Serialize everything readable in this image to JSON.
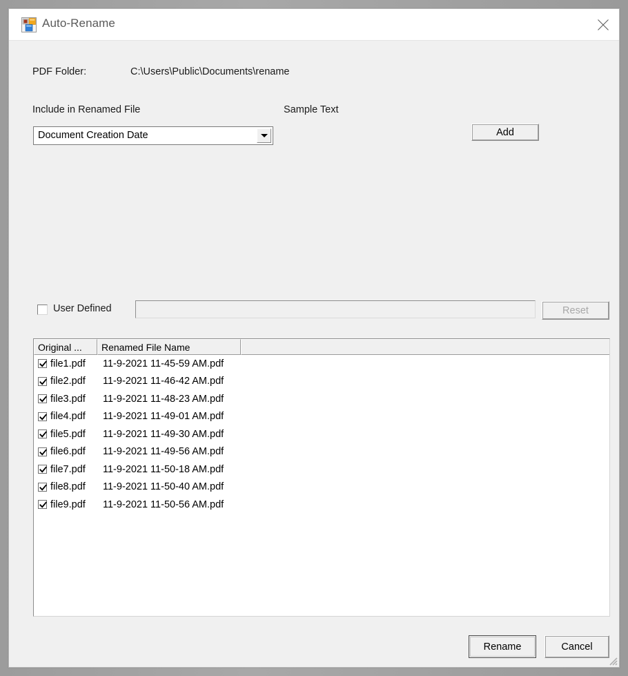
{
  "window": {
    "title": "Auto-Rename",
    "icon": "winforms-app-icon",
    "close_icon": "close-icon",
    "resize_grip": "resize-grip-icon"
  },
  "folder": {
    "label": "PDF Folder:",
    "path": "C:\\Users\\Public\\Documents\\rename"
  },
  "include_section": {
    "label": "Include in Renamed File",
    "sample_label": "Sample Text",
    "combo_value": "Document Creation Date",
    "combo_arrow_icon": "chevron-down-icon",
    "add_label": "Add"
  },
  "user_defined": {
    "label": "User Defined",
    "checked": false,
    "value": "",
    "placeholder": "",
    "reset_label": "Reset",
    "reset_enabled": false
  },
  "list": {
    "columns": [
      "Original ...",
      "Renamed File Name",
      ""
    ],
    "rows": [
      {
        "checked": true,
        "original": "file1.pdf",
        "renamed": "11-9-2021 11-45-59 AM.pdf"
      },
      {
        "checked": true,
        "original": "file2.pdf",
        "renamed": "11-9-2021 11-46-42 AM.pdf"
      },
      {
        "checked": true,
        "original": "file3.pdf",
        "renamed": "11-9-2021 11-48-23 AM.pdf"
      },
      {
        "checked": true,
        "original": "file4.pdf",
        "renamed": "11-9-2021 11-49-01 AM.pdf"
      },
      {
        "checked": true,
        "original": "file5.pdf",
        "renamed": "11-9-2021 11-49-30 AM.pdf"
      },
      {
        "checked": true,
        "original": "file6.pdf",
        "renamed": "11-9-2021 11-49-56 AM.pdf"
      },
      {
        "checked": true,
        "original": "file7.pdf",
        "renamed": "11-9-2021 11-50-18 AM.pdf"
      },
      {
        "checked": true,
        "original": "file8.pdf",
        "renamed": "11-9-2021 11-50-40 AM.pdf"
      },
      {
        "checked": true,
        "original": "file9.pdf",
        "renamed": "11-9-2021 11-50-56 AM.pdf"
      }
    ]
  },
  "footer": {
    "rename_label": "Rename",
    "cancel_label": "Cancel"
  },
  "colors": {
    "client_bg": "#f0f0f0",
    "titlebar_bg": "#ffffff",
    "title_text": "#5a5a5a",
    "list_bg": "#ffffff",
    "disabled_text": "#a8a8a8"
  }
}
